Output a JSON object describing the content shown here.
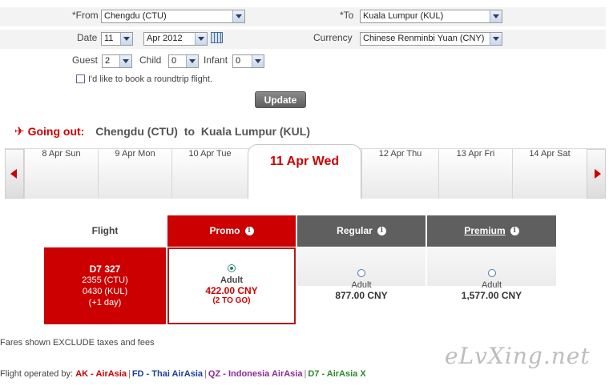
{
  "form": {
    "from_label": "*From",
    "from_value": "Chengdu (CTU)",
    "to_label": "*To",
    "to_value": "Kuala Lumpur (KUL)",
    "date_label": "Date",
    "date_day": "11",
    "date_month": "Apr 2012",
    "currency_label": "Currency",
    "currency_value": "Chinese Renminbi Yuan (CNY)",
    "guest_label": "Guest",
    "guest_value": "2",
    "child_label": "Child",
    "child_value": "0",
    "infant_label": "Infant",
    "infant_value": "0",
    "roundtrip_label": "I'd like to book a roundtrip flight.",
    "roundtrip_checked": false,
    "update_label": "Update"
  },
  "going_out": {
    "label": "Going out:",
    "origin": "Chengdu (CTU)",
    "to_word": "to",
    "destination": "Kuala Lumpur (KUL)"
  },
  "date_strip": {
    "days_before": [
      "8 Apr Sun",
      "9 Apr Mon",
      "10 Apr Tue"
    ],
    "selected_day": "11 Apr Wed",
    "days_after": [
      "12 Apr Thu",
      "13 Apr Fri",
      "14 Apr Sat"
    ]
  },
  "fare_table": {
    "flight_header": "Flight",
    "promo_header": "Promo",
    "regular_header": "Regular",
    "premium_header": "Premium",
    "flight": {
      "number": "D7  327",
      "depart": "2355 (CTU)",
      "arrive": "0430 (KUL)",
      "plus_day": "(+1 day)"
    },
    "promo": {
      "pax": "Adult",
      "price": "422.00 CNY",
      "seats": "(2 TO GO)",
      "selected": true
    },
    "regular": {
      "pax": "Adult",
      "price": "877.00 CNY",
      "selected": false
    },
    "premium": {
      "pax": "Adult",
      "price": "1,577.00 CNY",
      "selected": false
    },
    "colors": {
      "promo": "#cc0000",
      "standard": "#5f5f5f",
      "selected_border": "#b21a1a"
    }
  },
  "footer": {
    "note": "Fares shown EXCLUDE taxes and fees",
    "operated_label": "Flight operated by:",
    "operators": [
      {
        "text": "AK - AirAsia",
        "color": "#cc0000"
      },
      {
        "text": "FD - Thai AirAsia",
        "color": "#1a3f9a"
      },
      {
        "text": "QZ - Indonesia AirAsia",
        "color": "#8a2a9a"
      },
      {
        "text": "D7 - AirAsia X",
        "color": "#2a8a2a"
      }
    ],
    "separator": "|"
  },
  "watermark": "eLvXing.net"
}
